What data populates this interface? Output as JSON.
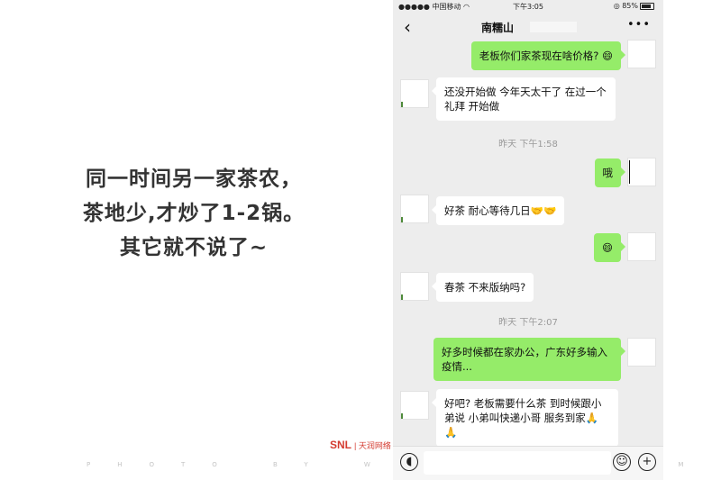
{
  "caption": {
    "line1": "同一时间另一家茶农，",
    "line2": "茶地少,才炒了1-2锅。",
    "line3": "其它就不说了~"
  },
  "watermark": "PHOTO BY WWW.SNL.COM",
  "brand": {
    "logo": "SNL",
    "sub": "| 天润网络"
  },
  "phone": {
    "status": {
      "carrier": "中国移动",
      "time": "下午3:05",
      "battery": "85%"
    },
    "title": "南糯山",
    "back_icon": "chevron-left-icon",
    "more_icon": "ellipsis-icon",
    "messages": [
      {
        "dir": "out",
        "text": "老板你们家茶现在啥价格? 😄"
      },
      {
        "dir": "in",
        "text": "还没开始做  今年天太干了  在过一个礼拜  开始做"
      },
      {
        "dir": "in",
        "text": "好茶  耐心等待几日🤝🤝"
      },
      {
        "dir": "out",
        "text": "哦"
      },
      {
        "dir": "out",
        "text": "😄"
      },
      {
        "dir": "in",
        "text": "春茶 不来版纳吗?"
      },
      {
        "dir": "out",
        "text": "好多时候都在家办公，广东好多输入疫情..."
      },
      {
        "dir": "in",
        "text": "好吧? 老板需要什么茶  到时候跟小弟说  小弟叫快递小哥 服务到家🙏🙏"
      }
    ],
    "timestamps": [
      "昨天 下午1:58",
      "昨天 下午2:07"
    ],
    "input": {
      "voice_icon": "voice-icon",
      "emoji_icon": "emoji-icon",
      "plus_icon": "plus-icon"
    },
    "colors": {
      "outgoing": "#95ec69",
      "incoming": "#ffffff",
      "background": "#ededed"
    }
  }
}
